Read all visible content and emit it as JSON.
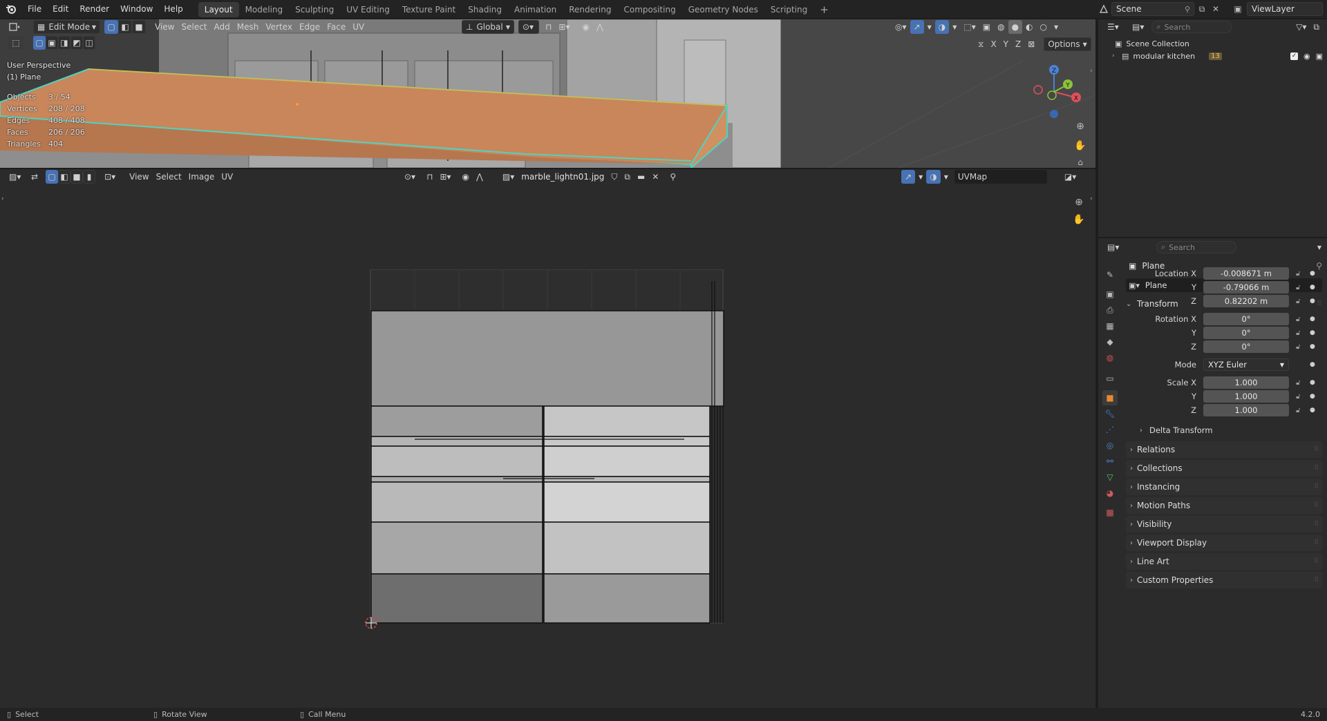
{
  "topbar": {
    "menus": [
      "File",
      "Edit",
      "Render",
      "Window",
      "Help"
    ],
    "workspaces": [
      "Layout",
      "Modeling",
      "Sculpting",
      "UV Editing",
      "Texture Paint",
      "Shading",
      "Animation",
      "Rendering",
      "Compositing",
      "Geometry Nodes",
      "Scripting"
    ],
    "active_workspace": "Layout",
    "scene": "Scene",
    "view_layer": "ViewLayer"
  },
  "viewport": {
    "mode": "Edit Mode",
    "menus": [
      "View",
      "Select",
      "Add",
      "Mesh",
      "Vertex",
      "Edge",
      "Face",
      "UV"
    ],
    "orientation": "Global",
    "options_label": "Options",
    "axis_labels": [
      "X",
      "Y",
      "Z"
    ],
    "view_name": "User Perspective",
    "object_name": "(1) Plane",
    "stats": [
      {
        "k": "Objects",
        "v": "3 / 54"
      },
      {
        "k": "Vertices",
        "v": "208 / 208"
      },
      {
        "k": "Edges",
        "v": "408 / 408"
      },
      {
        "k": "Faces",
        "v": "206 / 206"
      },
      {
        "k": "Triangles",
        "v": "404"
      }
    ],
    "gizmo": {
      "x": "X",
      "y": "Y",
      "z": "Z"
    }
  },
  "uv_editor": {
    "menus": [
      "View",
      "Select",
      "Image",
      "UV"
    ],
    "image_name": "marble_lightn01.jpg",
    "uvmap": "UVMap"
  },
  "outliner": {
    "search_placeholder": "Search",
    "root": "Scene Collection",
    "items": [
      {
        "label": "modular kitchen",
        "badge": "13"
      }
    ]
  },
  "properties": {
    "search_placeholder": "Search",
    "object_name": "Plane",
    "data_name": "Plane",
    "transform_label": "Transform",
    "location": {
      "label": "Location X",
      "x": "-0.008671 m",
      "y": "-0.79066 m",
      "z": "0.82202 m"
    },
    "rotation": {
      "label": "Rotation X",
      "x": "0°",
      "y": "0°",
      "z": "0°"
    },
    "mode": {
      "label": "Mode",
      "value": "XYZ Euler"
    },
    "scale": {
      "label": "Scale X",
      "x": "1.000",
      "y": "1.000",
      "z": "1.000"
    },
    "axis_y": "Y",
    "axis_z": "Z",
    "delta_transform": "Delta Transform",
    "panels": [
      "Relations",
      "Collections",
      "Instancing",
      "Motion Paths",
      "Visibility",
      "Viewport Display",
      "Line Art",
      "Custom Properties"
    ]
  },
  "statusbar": {
    "select": "Select",
    "rotate": "Rotate View",
    "call_menu": "Call Menu",
    "version": "4.2.0"
  },
  "colors": {
    "selection_orange": "#c9865a",
    "selection_edge": "#4fd3c4",
    "accent_blue": "#4772b3",
    "panel_bg": "#2b2b2b"
  }
}
